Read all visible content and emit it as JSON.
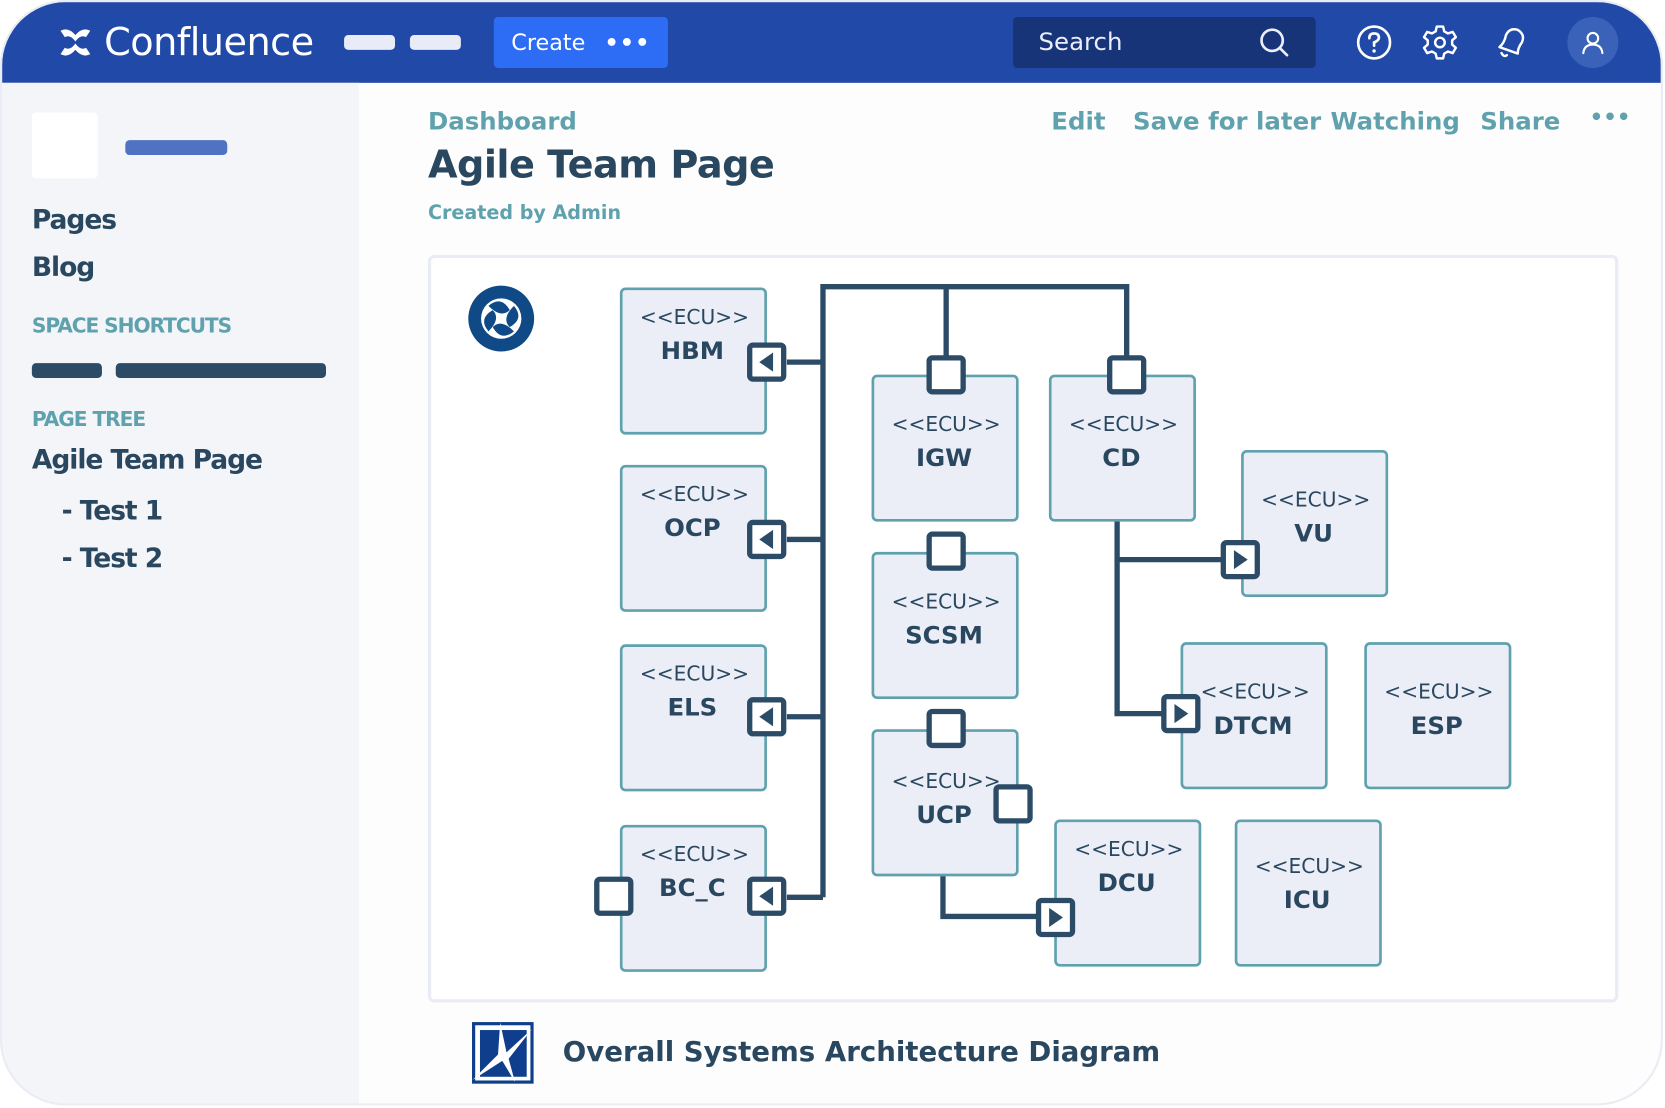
{
  "app": {
    "name": "Confluence"
  },
  "topbar": {
    "create_label": "Create",
    "more_label": "•••",
    "search_placeholder": "Search",
    "icons": [
      "search-icon",
      "help-icon",
      "gear-icon",
      "bell-icon",
      "user-icon"
    ]
  },
  "colors": {
    "brand": "#2049a8",
    "create": "#2d6df6",
    "search_bg": "#183478",
    "link_teal": "#5fa2ad",
    "text_dark": "#2a4760",
    "node_fill": "#ebeef7",
    "node_border": "#5fa2ad",
    "connector": "#2b4b66"
  },
  "sidebar": {
    "nav": [
      {
        "label": "Pages"
      },
      {
        "label": "Blog"
      }
    ],
    "shortcuts_heading": "SPACE SHORTCUTS",
    "page_tree_heading": "PAGE TREE",
    "tree": [
      {
        "label": "Agile Team Page",
        "level": 0
      },
      {
        "label": "- Test 1",
        "level": 1
      },
      {
        "label": "- Test 2",
        "level": 1
      }
    ]
  },
  "page": {
    "breadcrumb": "Dashboard",
    "actions": [
      {
        "label": "Edit"
      },
      {
        "label": "Save for later"
      },
      {
        "label": "Watching"
      },
      {
        "label": "Share"
      },
      {
        "label": "•••"
      }
    ],
    "title": "Agile Team Page",
    "byline": "Created by Admin"
  },
  "diagram": {
    "stereotype": "<<ECU>>",
    "nodes": [
      {
        "id": "HBM"
      },
      {
        "id": "OCP"
      },
      {
        "id": "ELS"
      },
      {
        "id": "BC_C"
      },
      {
        "id": "IGW"
      },
      {
        "id": "SCSM"
      },
      {
        "id": "UCP"
      },
      {
        "id": "CD"
      },
      {
        "id": "VU"
      },
      {
        "id": "DTCM"
      },
      {
        "id": "ESP"
      },
      {
        "id": "DCU"
      },
      {
        "id": "ICU"
      }
    ],
    "caption": "Overall Systems Architecture Diagram"
  }
}
